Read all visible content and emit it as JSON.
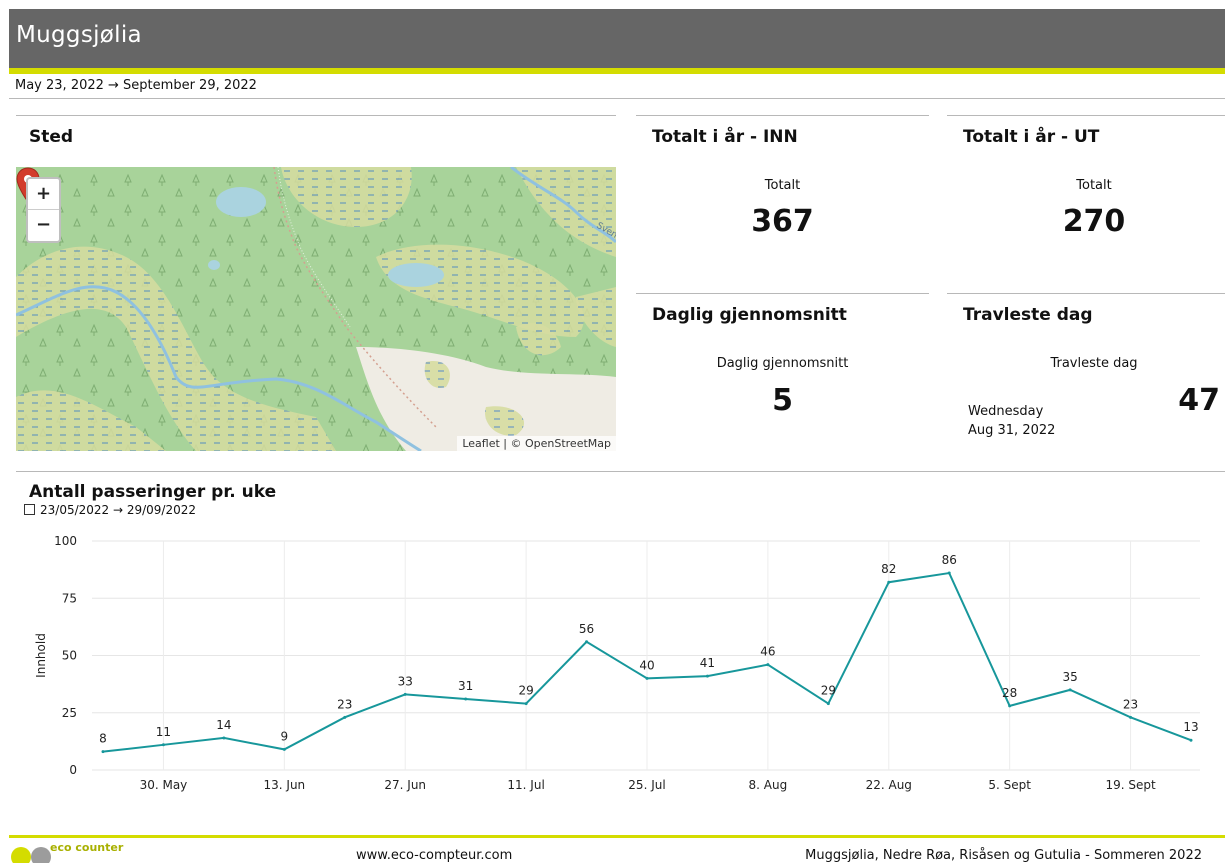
{
  "header": {
    "title": "Muggsjølia"
  },
  "date_range": "May 23, 2022 → September 29, 2022",
  "location_panel": {
    "title": "Sted",
    "zoom_in": "+",
    "zoom_out": "−",
    "attribution": "Leaflet | © OpenStreetMap",
    "map_label": "Sven"
  },
  "total_in": {
    "title": "Totalt i år - INN",
    "label": "Totalt",
    "value": "367"
  },
  "total_out": {
    "title": "Totalt i år - UT",
    "label": "Totalt",
    "value": "270"
  },
  "daily_avg": {
    "title": "Daglig gjennomsnitt",
    "label": "Daglig gjennomsnitt",
    "value": "5"
  },
  "busiest_day": {
    "title": "Travleste dag",
    "label": "Travleste dag",
    "weekday": "Wednesday",
    "date": "Aug 31, 2022",
    "value": "47"
  },
  "chart_section": {
    "title": "Antall passeringer pr. uke",
    "range": "23/05/2022 → 29/09/2022"
  },
  "chart_data": {
    "type": "line",
    "title": "Antall passeringer pr. uke",
    "xlabel": "",
    "ylabel": "Innhold",
    "ylim": [
      0,
      100
    ],
    "yticks": [
      0,
      25,
      50,
      75,
      100
    ],
    "x": [
      "23/05/2022",
      "30/05/2022",
      "06/06/2022",
      "13/06/2022",
      "20/06/2022",
      "27/06/2022",
      "04/07/2022",
      "11/07/2022",
      "18/07/2022",
      "25/07/2022",
      "01/08/2022",
      "08/08/2022",
      "15/08/2022",
      "22/08/2022",
      "29/08/2022",
      "05/09/2022",
      "12/09/2022",
      "19/09/2022",
      "26/09/2022"
    ],
    "xtick_labels": [
      {
        "index": 1,
        "label": "30. May"
      },
      {
        "index": 3,
        "label": "13. Jun"
      },
      {
        "index": 5,
        "label": "27. Jun"
      },
      {
        "index": 7,
        "label": "11. Jul"
      },
      {
        "index": 9,
        "label": "25. Jul"
      },
      {
        "index": 11,
        "label": "8. Aug"
      },
      {
        "index": 13,
        "label": "22. Aug"
      },
      {
        "index": 15,
        "label": "5. Sept"
      },
      {
        "index": 17,
        "label": "19. Sept"
      }
    ],
    "series": [
      {
        "values": [
          8,
          11,
          14,
          9,
          23,
          33,
          31,
          29,
          56,
          40,
          41,
          46,
          29,
          82,
          86,
          28,
          35,
          23,
          13
        ]
      }
    ],
    "grid": true,
    "color": "#17979b"
  },
  "footer": {
    "url": "www.eco-compteur.com",
    "report_title": "Muggsjølia, Nedre Røa, Risåsen og Gutulia - Sommeren 2022",
    "logo_text": "eco counter"
  },
  "colors": {
    "accent": "#d4dc00",
    "header_bg": "#666666",
    "line": "#17979b",
    "marker": "#d23b2b"
  }
}
